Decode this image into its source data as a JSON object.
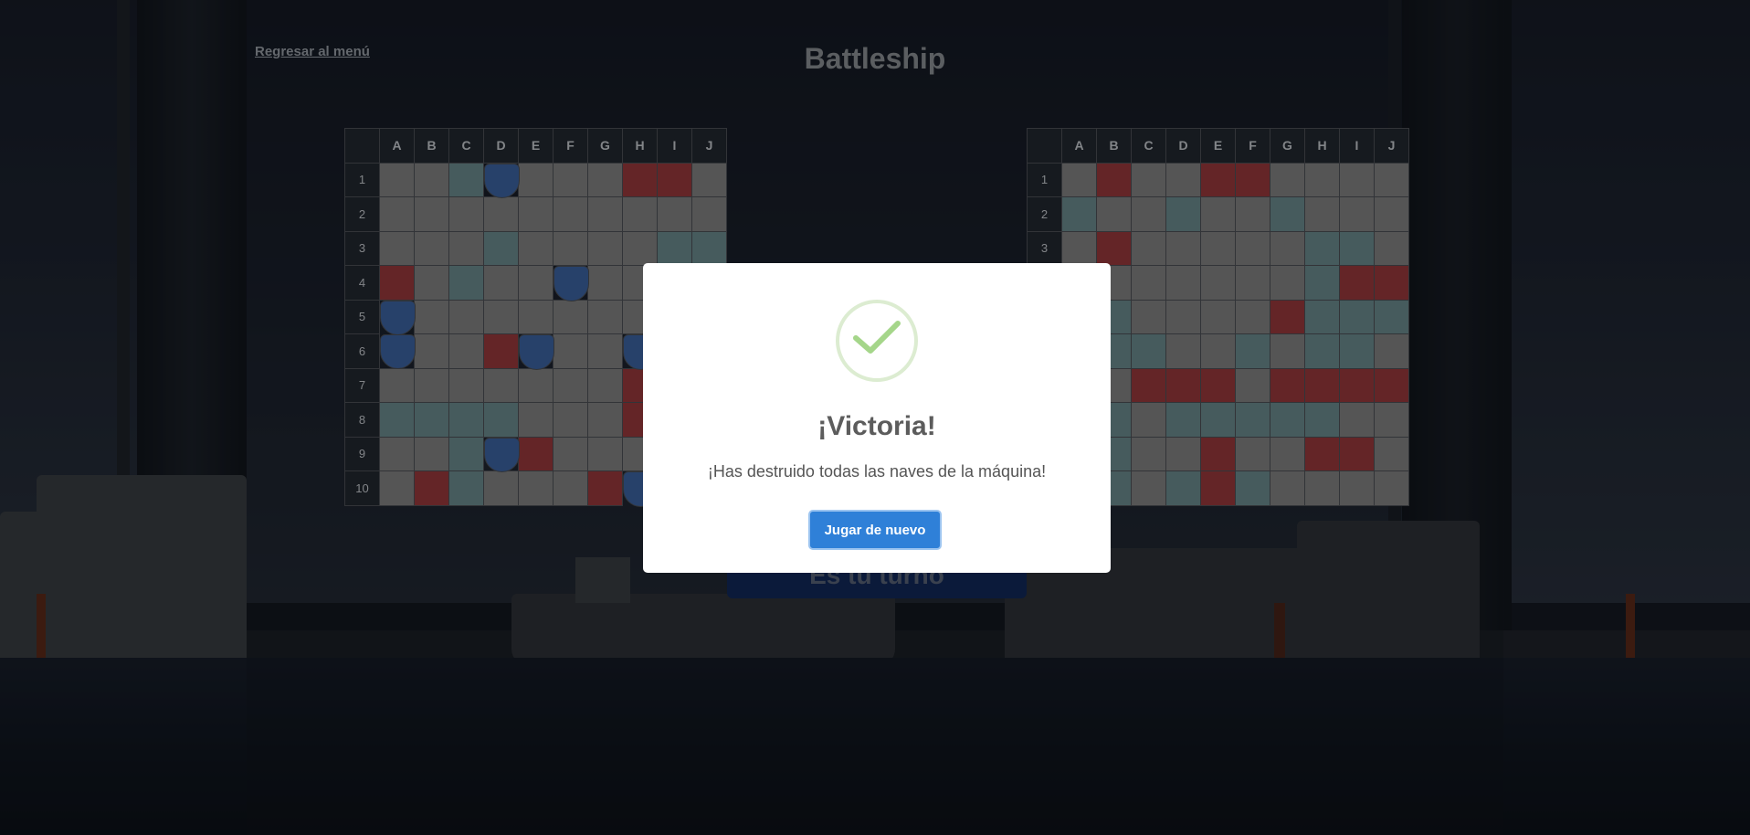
{
  "header": {
    "back_link": "Regresar al menú",
    "title": "Battleship"
  },
  "boards": {
    "columns": [
      "A",
      "B",
      "C",
      "D",
      "E",
      "F",
      "G",
      "H",
      "I",
      "J"
    ],
    "rows": [
      "1",
      "2",
      "3",
      "4",
      "5",
      "6",
      "7",
      "8",
      "9",
      "10"
    ],
    "legend_colors": {
      "hit": "#9a3a3c",
      "miss": "#6c8c90",
      "ship": "#3c64a3",
      "empty": "#838383"
    },
    "player": [
      "..mS...HH.",
      "..........",
      "...m....mm",
      "H.m..S....",
      "S.........",
      "S..HS..S..",
      ".......H..",
      "mmmm...H..",
      "..mSH.....",
      ".Hm...HS.."
    ],
    "enemy": [
      ".H..HH....",
      "m..m..m...",
      ".H.....mm.",
      ".......mHH",
      "mm....Hmmm",
      "mmm..m.mm.",
      "m.HHH.HHHH",
      ".m.mmmmm..",
      ".m..H..HH.",
      ".m.mHm...."
    ]
  },
  "status": {
    "turn_text": "Es tu turno"
  },
  "modal": {
    "title": "¡Victoria!",
    "text": "¡Has destruido todas las naves de la máquina!",
    "button": "Jugar de nuevo",
    "accent": "#2f80d8",
    "icon": "check-icon"
  }
}
